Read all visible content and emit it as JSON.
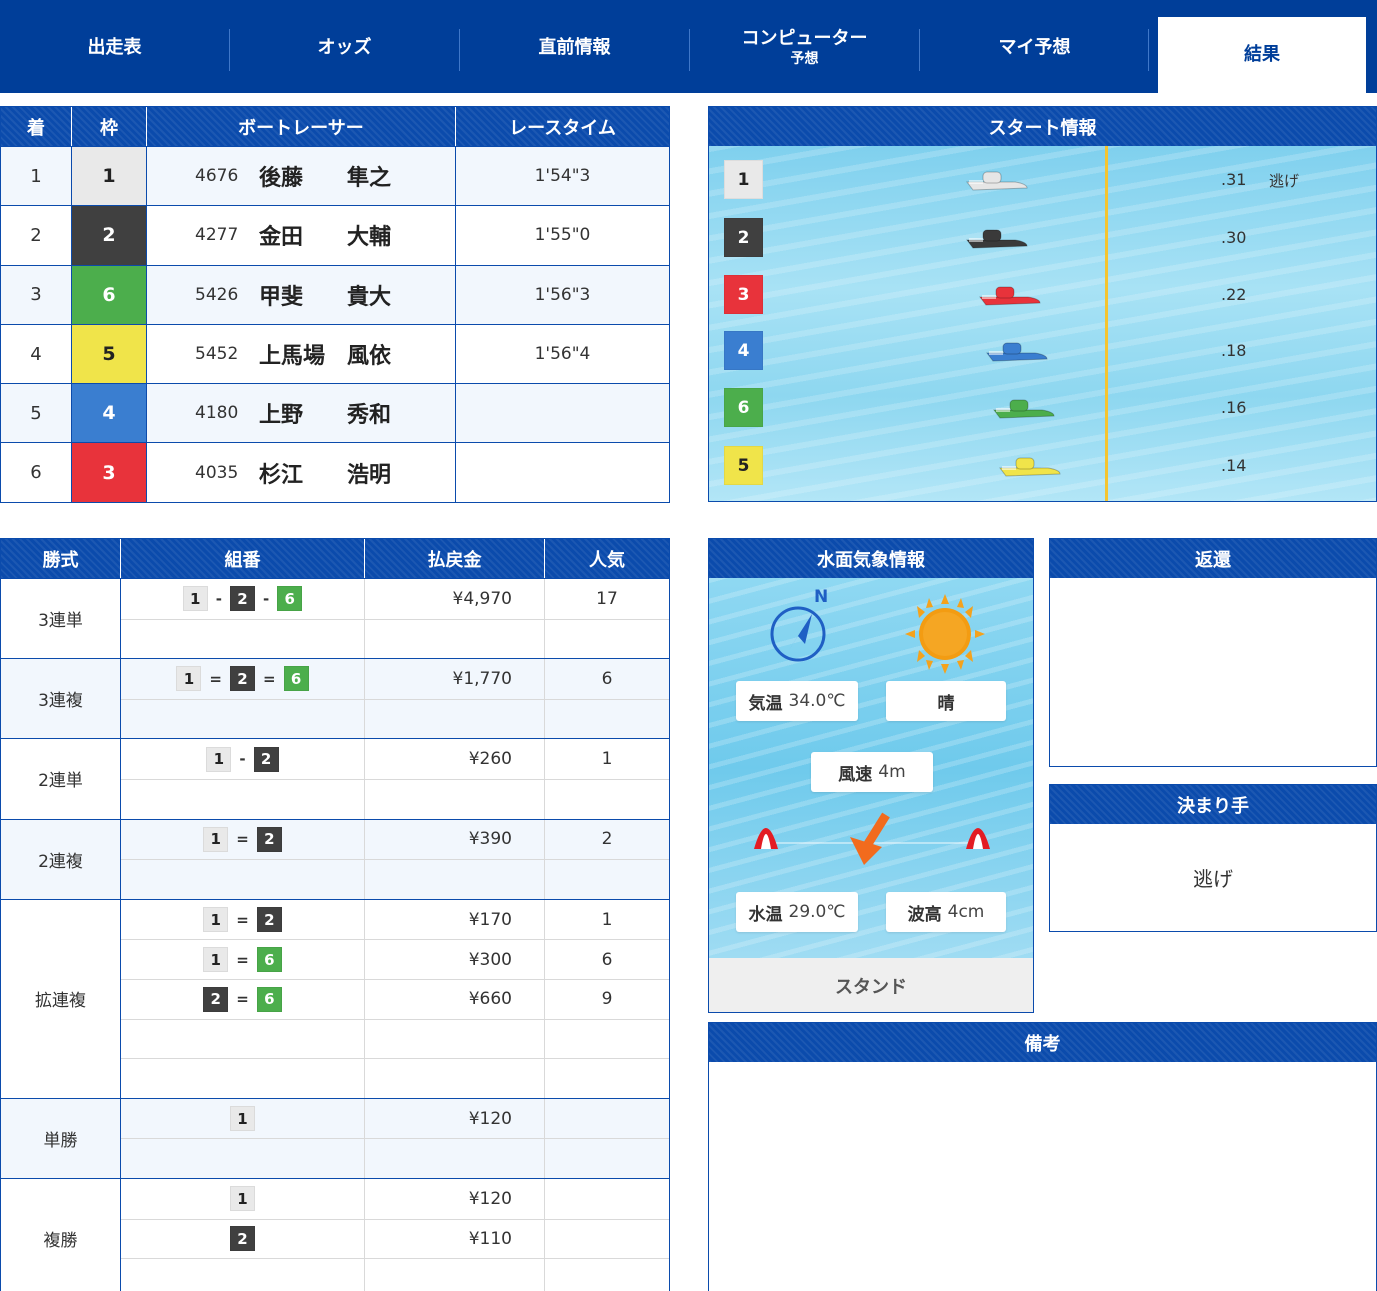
{
  "nav": {
    "tabs": [
      {
        "label": "出走表",
        "sub": ""
      },
      {
        "label": "オッズ",
        "sub": ""
      },
      {
        "label": "直前情報",
        "sub": ""
      },
      {
        "label": "コンピューター",
        "sub": "予想"
      },
      {
        "label": "マイ予想",
        "sub": ""
      },
      {
        "label": "結果",
        "sub": ""
      }
    ]
  },
  "result": {
    "headers": [
      "着",
      "枠",
      "ボートレーサー",
      "レースタイム"
    ],
    "rows": [
      {
        "rank": "1",
        "frame": "1",
        "racer_id": "4676",
        "name": "後藤　　隼之",
        "time": "1'54\"3"
      },
      {
        "rank": "2",
        "frame": "2",
        "racer_id": "4277",
        "name": "金田　　大輔",
        "time": "1'55\"0"
      },
      {
        "rank": "3",
        "frame": "6",
        "racer_id": "5426",
        "name": "甲斐　　貴大",
        "time": "1'56\"3"
      },
      {
        "rank": "4",
        "frame": "5",
        "racer_id": "5452",
        "name": "上馬場　風依",
        "time": "1'56\"4"
      },
      {
        "rank": "5",
        "frame": "4",
        "racer_id": "4180",
        "name": "上野　　秀和",
        "time": ""
      },
      {
        "rank": "6",
        "frame": "3",
        "racer_id": "4035",
        "name": "杉江　　浩明",
        "time": ""
      }
    ]
  },
  "start_info": {
    "title": "スタート情報",
    "rows": [
      {
        "lane": "1",
        "st": ".31",
        "kimarite": "逃げ",
        "boat_color": "#e6e6e6",
        "boat_offset": 0.49
      },
      {
        "lane": "2",
        "st": ".30",
        "kimarite": "",
        "boat_color": "#3a3a3a",
        "boat_offset": 0.49
      },
      {
        "lane": "3",
        "st": ".22",
        "kimarite": "",
        "boat_color": "#e8333b",
        "boat_offset": 0.51
      },
      {
        "lane": "4",
        "st": ".18",
        "kimarite": "",
        "boat_color": "#3a7ed0",
        "boat_offset": 0.52
      },
      {
        "lane": "6",
        "st": ".16",
        "kimarite": "",
        "boat_color": "#4cae4c",
        "boat_offset": 0.53
      },
      {
        "lane": "5",
        "st": ".14",
        "kimarite": "",
        "boat_color": "#f0e44a",
        "boat_offset": 0.54
      }
    ]
  },
  "payout": {
    "headers": [
      "勝式",
      "組番",
      "払戻金",
      "人気"
    ],
    "groups": [
      {
        "kind": "3連単",
        "lines": [
          {
            "comb": [
              "1",
              "2",
              "6"
            ],
            "sep": "-",
            "amount": "¥4,970",
            "pop": "17"
          },
          {
            "comb": [],
            "sep": "",
            "amount": "",
            "pop": ""
          }
        ]
      },
      {
        "kind": "3連複",
        "lines": [
          {
            "comb": [
              "1",
              "2",
              "6"
            ],
            "sep": "=",
            "amount": "¥1,770",
            "pop": "6"
          },
          {
            "comb": [],
            "sep": "",
            "amount": "",
            "pop": ""
          }
        ]
      },
      {
        "kind": "2連単",
        "lines": [
          {
            "comb": [
              "1",
              "2"
            ],
            "sep": "-",
            "amount": "¥260",
            "pop": "1"
          },
          {
            "comb": [],
            "sep": "",
            "amount": "",
            "pop": ""
          }
        ]
      },
      {
        "kind": "2連複",
        "lines": [
          {
            "comb": [
              "1",
              "2"
            ],
            "sep": "=",
            "amount": "¥390",
            "pop": "2"
          },
          {
            "comb": [],
            "sep": "",
            "amount": "",
            "pop": ""
          }
        ]
      },
      {
        "kind": "拡連複",
        "lines": [
          {
            "comb": [
              "1",
              "2"
            ],
            "sep": "=",
            "amount": "¥170",
            "pop": "1"
          },
          {
            "comb": [
              "1",
              "6"
            ],
            "sep": "=",
            "amount": "¥300",
            "pop": "6"
          },
          {
            "comb": [
              "2",
              "6"
            ],
            "sep": "=",
            "amount": "¥660",
            "pop": "9"
          },
          {
            "comb": [],
            "sep": "",
            "amount": "",
            "pop": ""
          },
          {
            "comb": [],
            "sep": "",
            "amount": "",
            "pop": ""
          }
        ]
      },
      {
        "kind": "単勝",
        "lines": [
          {
            "comb": [
              "1"
            ],
            "sep": "",
            "amount": "¥120",
            "pop": ""
          },
          {
            "comb": [],
            "sep": "",
            "amount": "",
            "pop": ""
          }
        ]
      },
      {
        "kind": "複勝",
        "lines": [
          {
            "comb": [
              "1"
            ],
            "sep": "",
            "amount": "¥120",
            "pop": ""
          },
          {
            "comb": [
              "2"
            ],
            "sep": "",
            "amount": "¥110",
            "pop": ""
          },
          {
            "comb": [],
            "sep": "",
            "amount": "",
            "pop": ""
          }
        ]
      }
    ]
  },
  "weather": {
    "title": "水面気象情報",
    "north": "N",
    "temp_label": "気温",
    "temp_value": "34.0℃",
    "condition": "晴",
    "wind_label": "風速",
    "wind_value": "4m",
    "water_temp_label": "水温",
    "water_temp_value": "29.0℃",
    "wave_label": "波高",
    "wave_value": "4cm",
    "stand": "スタンド"
  },
  "refund": {
    "title": "返還",
    "value": ""
  },
  "kimarite": {
    "title": "決まり手",
    "value": "逃げ"
  },
  "remarks": {
    "title": "備考",
    "value": ""
  },
  "colors": {
    "header": "#0b4bac",
    "nav": "#003e99",
    "finish_line": "#f4c430"
  }
}
